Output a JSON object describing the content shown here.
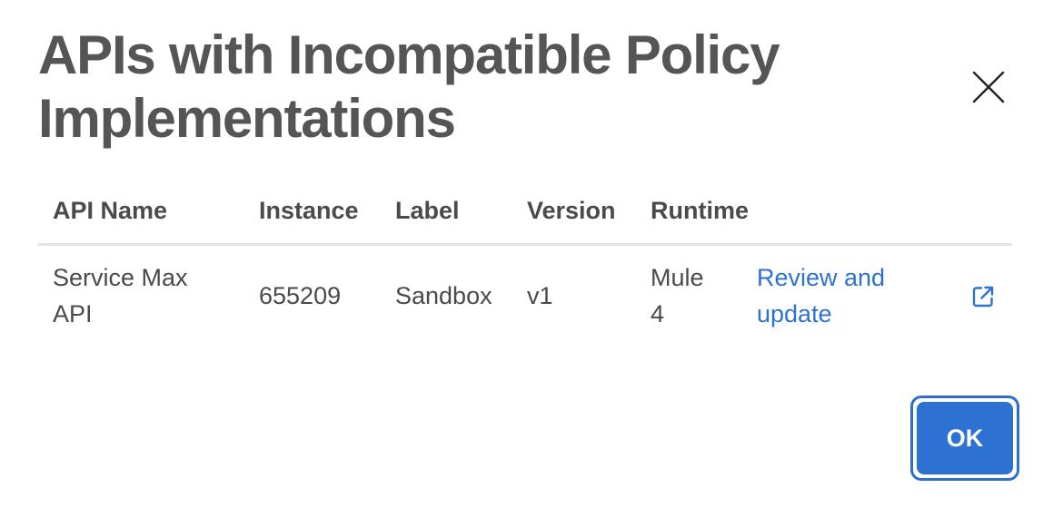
{
  "dialog": {
    "title": "APIs with Incompatible Policy Implementations",
    "close_icon": "close-icon"
  },
  "table": {
    "headers": [
      "API Name",
      "Instance",
      "Label",
      "Version",
      "Runtime"
    ],
    "rows": [
      {
        "api_name": "Service Max API",
        "instance": "655209",
        "label": "Sandbox",
        "version": "v1",
        "runtime": "Mule 4",
        "action_label": "Review and update",
        "action_icon": "external-link-icon"
      }
    ]
  },
  "footer": {
    "ok_label": "OK"
  },
  "colors": {
    "title": "#555555",
    "text": "#4a4a4a",
    "link": "#2d72d2",
    "primary_button": "#2d72d2",
    "divider": "#e4e4e4"
  }
}
